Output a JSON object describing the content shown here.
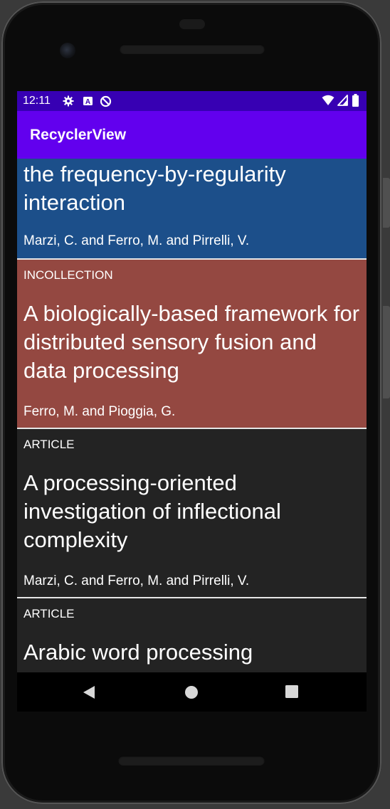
{
  "status_bar": {
    "time": "12:11",
    "icons_left": [
      "gear-icon",
      "a-badge-icon",
      "data-saver-icon"
    ],
    "icons_right": [
      "wifi-icon",
      "signal-icon",
      "battery-icon"
    ]
  },
  "app_bar": {
    "title": "RecyclerView",
    "color": "#6200ee",
    "status_color": "#3700b3"
  },
  "items": [
    {
      "type": "",
      "title": "the frequency-by-regularity interaction",
      "author": "Marzi, C. and Ferro, M. and Pirrelli, V.",
      "color": "#1c4f8a"
    },
    {
      "type": "INCOLLECTION",
      "title": "A biologically-based framework for distributed sensory fusion and data processing",
      "author": "Ferro, M. and Pioggia, G.",
      "color": "#944841"
    },
    {
      "type": "ARTICLE",
      "title": "A processing-oriented investigation of inflectional complexity",
      "author": "Marzi, C. and Ferro, M. and Pirrelli, V.",
      "color": "#232323"
    },
    {
      "type": "ARTICLE",
      "title": "Arabic word processing",
      "author": "",
      "color": "#232323"
    }
  ],
  "nav": {
    "back": "back-icon",
    "home": "home-icon",
    "recents": "recents-icon"
  }
}
